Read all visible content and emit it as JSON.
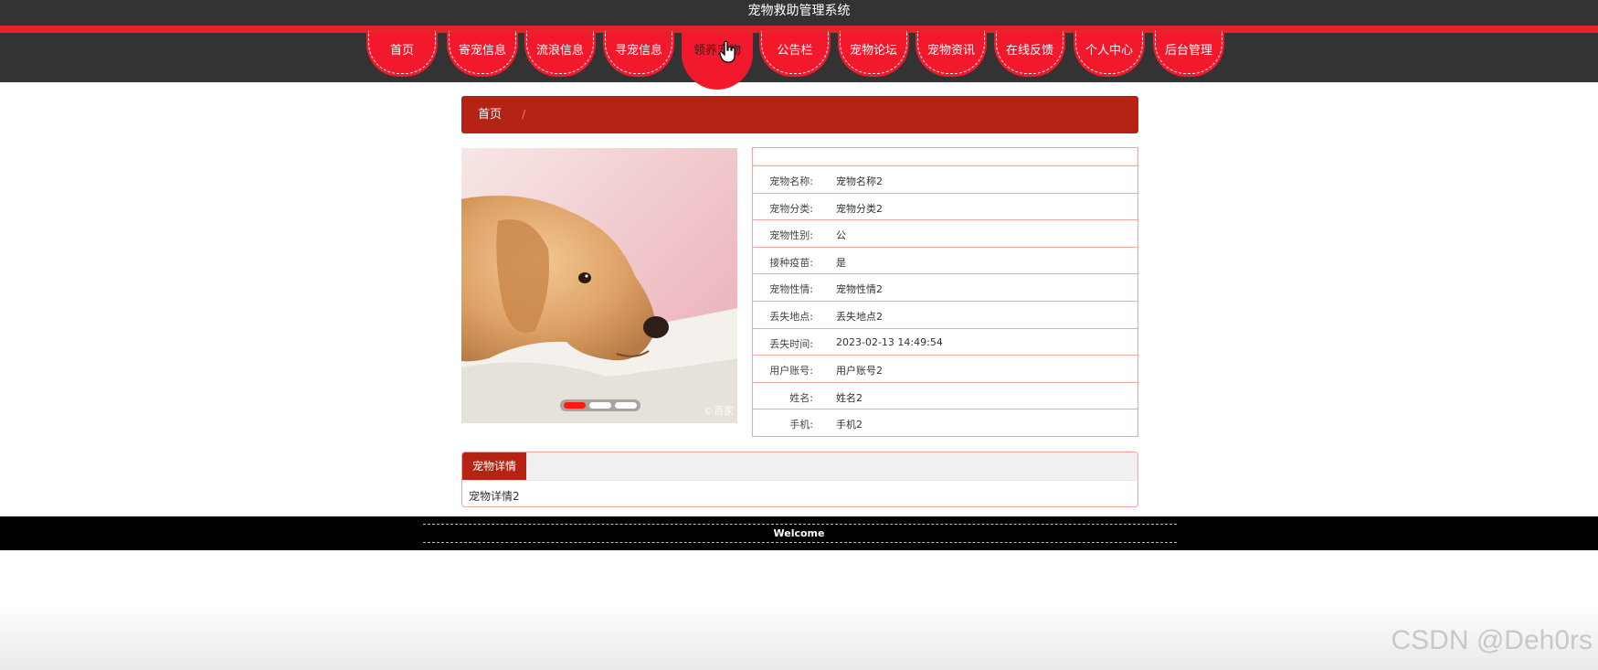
{
  "app_title": "宠物救助管理系统",
  "nav": [
    {
      "label": "首页"
    },
    {
      "label": "寄宠信息"
    },
    {
      "label": "流浪信息"
    },
    {
      "label": "寻宠信息"
    },
    {
      "label": "领养宠物"
    },
    {
      "label": "公告栏"
    },
    {
      "label": "宠物论坛"
    },
    {
      "label": "宠物资讯"
    },
    {
      "label": "在线反馈"
    },
    {
      "label": "个人中心"
    },
    {
      "label": "后台管理"
    }
  ],
  "active_nav": "领养宠物",
  "breadcrumb": {
    "home": "首页",
    "separator": "/"
  },
  "carousel": {
    "slides": 3,
    "active_index": 0,
    "watermark": "©百家"
  },
  "details": [
    {
      "label": "宠物名称:",
      "value": "宠物名称2"
    },
    {
      "label": "宠物分类:",
      "value": "宠物分类2"
    },
    {
      "label": "宠物性别:",
      "value": "公"
    },
    {
      "label": "接种疫苗:",
      "value": "是"
    },
    {
      "label": "宠物性情:",
      "value": "宠物性情2"
    },
    {
      "label": "丢失地点:",
      "value": "丢失地点2"
    },
    {
      "label": "丢失时间:",
      "value": "2023-02-13 14:49:54"
    },
    {
      "label": "用户账号:",
      "value": "用户账号2"
    },
    {
      "label": "姓名:",
      "value": "姓名2"
    },
    {
      "label": "手机:",
      "value": "手机2"
    }
  ],
  "detail_tab": {
    "label": "宠物详情",
    "content": "宠物详情2"
  },
  "footer": {
    "text": "Welcome"
  },
  "watermark": "CSDN @Deh0rs",
  "colors": {
    "header_bg": "#333333",
    "accent_red": "#f3192c",
    "breadcrumb_red": "#b52314",
    "border_pink": "#f1a79f"
  }
}
